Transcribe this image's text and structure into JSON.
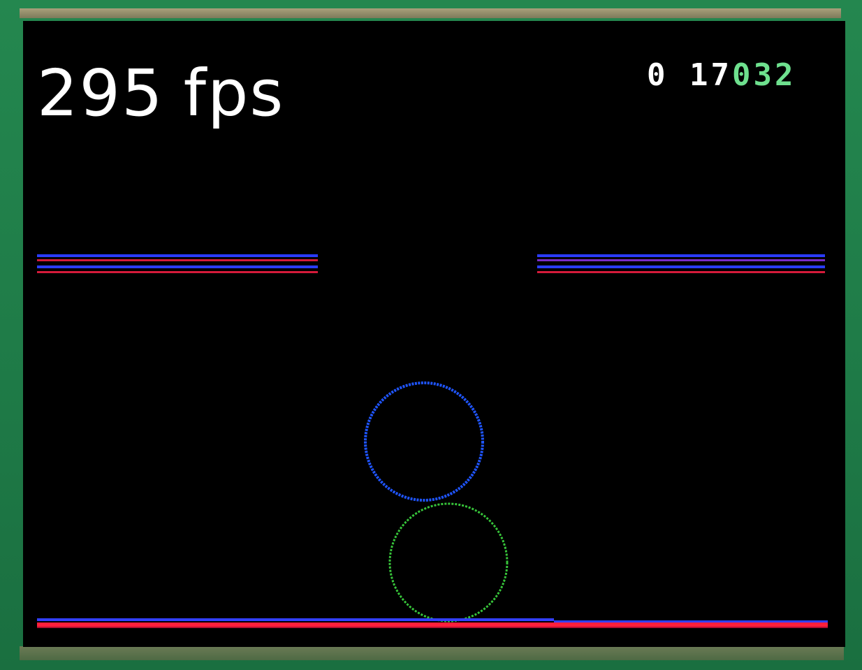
{
  "hud": {
    "fps_value": "295",
    "fps_unit": "fps",
    "score_left": "0 17",
    "score_right": "032"
  },
  "colors": {
    "screen_background": "#000000",
    "device_frame": "#1f7c48",
    "fps_text": "#ffffff",
    "score_left_text": "#ffffff",
    "score_right_text": "#6ee08e",
    "line_blue": "#2a3cff",
    "line_red": "#d41a3a",
    "line_purple": "#7a2cc8",
    "ring_top": "#1f55ff",
    "ring_bottom": "#37c43a",
    "floor_red": "#ff1f3b",
    "floor_blue": "#3340ff"
  },
  "scene": {
    "platforms": [
      "left-ledge",
      "right-ledge",
      "floor"
    ],
    "balls": [
      "blue-ring",
      "green-ring"
    ]
  }
}
